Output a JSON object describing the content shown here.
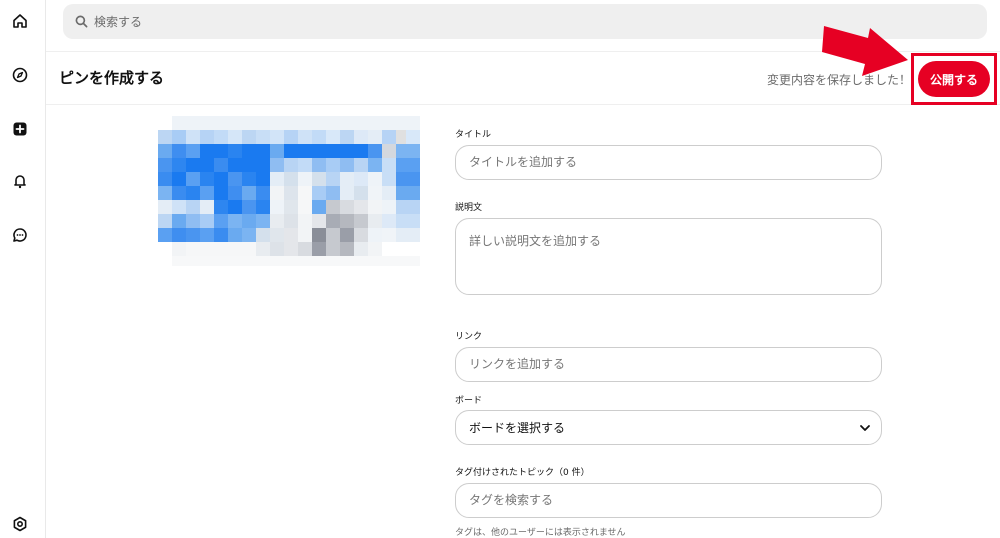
{
  "search": {
    "placeholder": "検索する"
  },
  "header": {
    "title": "ピンを作成する",
    "saved_message": "変更内容を保存しました！",
    "publish_label": "公開する"
  },
  "form": {
    "title_label": "タイトル",
    "title_placeholder": "タイトルを追加する",
    "description_label": "説明文",
    "description_placeholder": "詳しい説明文を追加する",
    "link_label": "リンク",
    "link_placeholder": "リンクを追加する",
    "board_label": "ボード",
    "board_value": "ボードを選択する",
    "tags_label": "タグ付けされたトピック（0 件）",
    "tags_placeholder": "タグを検索する",
    "tags_hint": "タグは、他のユーザーには表示されません"
  },
  "colors": {
    "accent": "#e60023",
    "annotation_red": "#e60023"
  },
  "icons": [
    "home-icon",
    "compass-icon",
    "create-icon",
    "bell-icon",
    "chat-icon",
    "settings-icon",
    "search-icon",
    "chevron-down-icon",
    "arrow-annotation"
  ]
}
